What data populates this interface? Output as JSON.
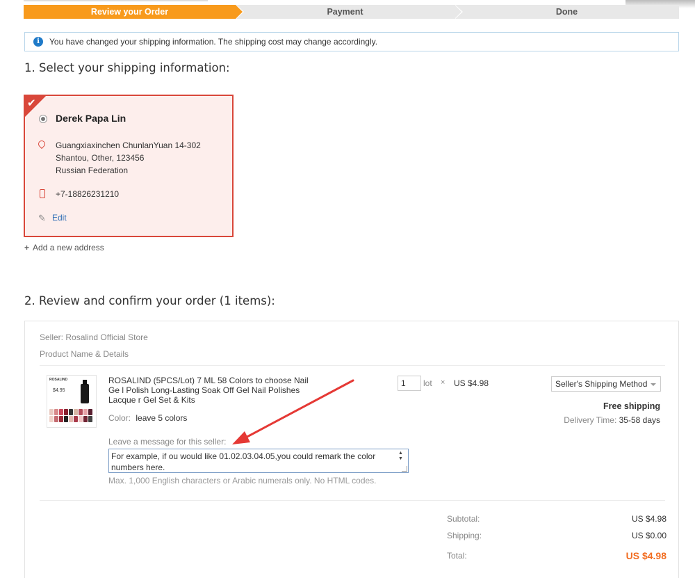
{
  "steps": [
    {
      "label": "Review your Order",
      "active": true
    },
    {
      "label": "Payment",
      "active": false
    },
    {
      "label": "Done",
      "active": false
    }
  ],
  "notice": {
    "icon": "info-icon",
    "text": "You have changed your shipping information. The shipping cost may change accordingly."
  },
  "shipping_section": {
    "title": "1. Select your shipping information:",
    "address": {
      "name": "Derek Papa Lin",
      "line1": "Guangxiaxinchen ChunlanYuan 14-302",
      "line2": "Shantou, Other, 123456",
      "line3": "Russian Federation",
      "phone": "+7-18826231210",
      "edit_label": "Edit"
    },
    "add_address_label": "Add a new address"
  },
  "order_section": {
    "title": "2. Review and confirm your order (1 items):",
    "seller": "Seller: Rosalind Official Store",
    "product_header": "Product Name & Details",
    "thumb": {
      "brand": "ROSALIND",
      "price": "$4.95"
    },
    "product": {
      "title": "ROSALIND (5PCS/Lot) 7 ML 58 Colors to choose Nail Ge l Polish Long-Lasting Soak Off Gel Nail Polishes Lacque r Gel Set & Kits",
      "color_label": "Color:",
      "color_value": "leave 5 colors",
      "quantity": "1",
      "unit": "lot",
      "times": "×",
      "unit_price": "US $4.98"
    },
    "shipping": {
      "method": "Seller's Shipping Method",
      "cost_label": "Free shipping",
      "delivery_label": "Delivery Time:",
      "delivery_value": "35-58 days"
    },
    "message": {
      "label": "Leave a message for this seller:",
      "value": "For example, if ou would like 01.02.03.04.05,you could remark the color numbers here.",
      "hint": "Max. 1,000 English characters or Arabic numerals only. No HTML codes."
    },
    "summary": {
      "subtotal_label": "Subtotal:",
      "subtotal_value": "US $4.98",
      "shipping_label": "Shipping:",
      "shipping_value": "US $0.00",
      "total_label": "Total:",
      "total_value": "US $4.98"
    }
  },
  "colors": {
    "accent_orange": "#f89a1c",
    "selected_border": "#d9473a",
    "total_orange": "#f26d21",
    "link_blue": "#2f6eb5"
  }
}
